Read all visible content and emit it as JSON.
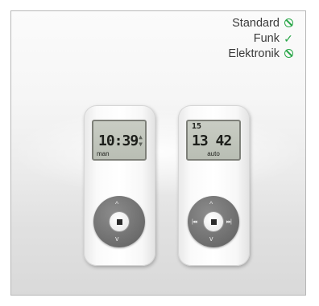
{
  "features": [
    {
      "label": "Standard",
      "status": "unavailable",
      "icon": "no-sign-icon"
    },
    {
      "label": "Funk",
      "status": "available",
      "icon": "check-icon"
    },
    {
      "label": "Elektronik",
      "status": "unavailable",
      "icon": "no-sign-icon"
    }
  ],
  "colors": {
    "accent": "#29a648"
  },
  "remote_left": {
    "time": "10:39",
    "mode": "man",
    "arrows_icon": "up-down-arrows-icon",
    "up_arrow": "^",
    "down_arrow": "v"
  },
  "remote_right": {
    "date": "15",
    "time": "13 42",
    "mode": "auto",
    "up_arrow": "^",
    "down_arrow": "v",
    "left_arrow": "|◂◂",
    "right_arrow": "▸▸|"
  }
}
